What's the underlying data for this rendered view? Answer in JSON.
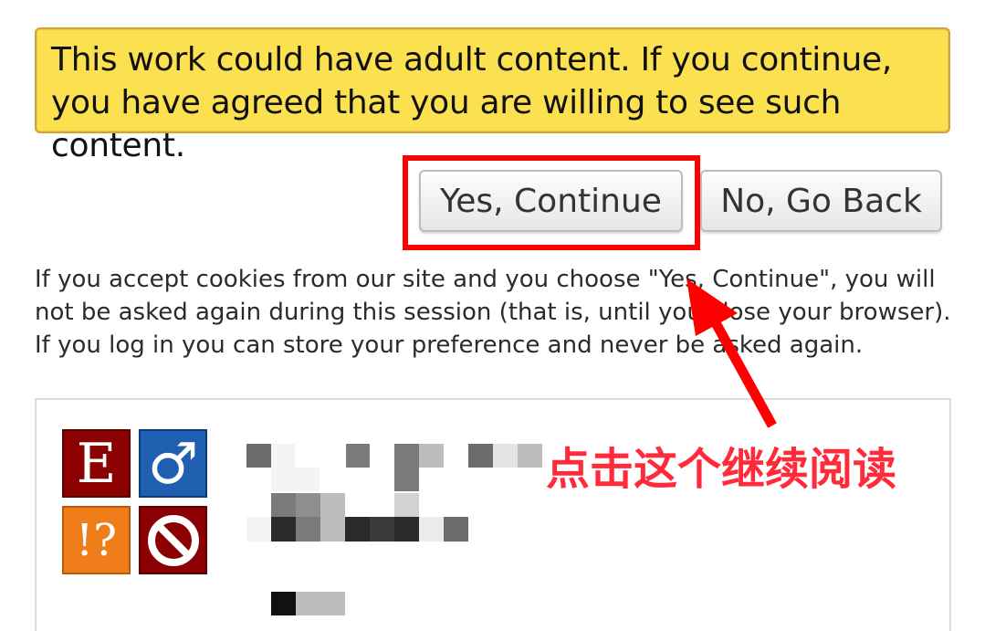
{
  "notice": {
    "text": "This work could have adult content. If you continue, you have agreed that you are willing to see such content."
  },
  "buttons": {
    "yes_label": "Yes, Continue",
    "no_label": "No, Go Back"
  },
  "info_text": "If you accept cookies from our site and you choose \"Yes, Continue\", you will not be asked again during this session (that is, until you close your browser). If you log in you can store your preference and never be asked again.",
  "work": {
    "required_tags": {
      "rating": {
        "glyph": "E",
        "color": "#8b0000"
      },
      "orientation": {
        "glyph": "♂",
        "color": "#1e5fb0"
      },
      "warning": {
        "glyph": "!?",
        "color": "#ee7d1a"
      },
      "complete": {
        "icon": "no-entry-icon",
        "color": "#8b0000"
      }
    }
  },
  "annotation": {
    "text": "点击这个继续阅读",
    "color": "#ff2a3a"
  },
  "colors": {
    "notice_bg": "#fbe04f",
    "highlight": "#ff0000"
  }
}
